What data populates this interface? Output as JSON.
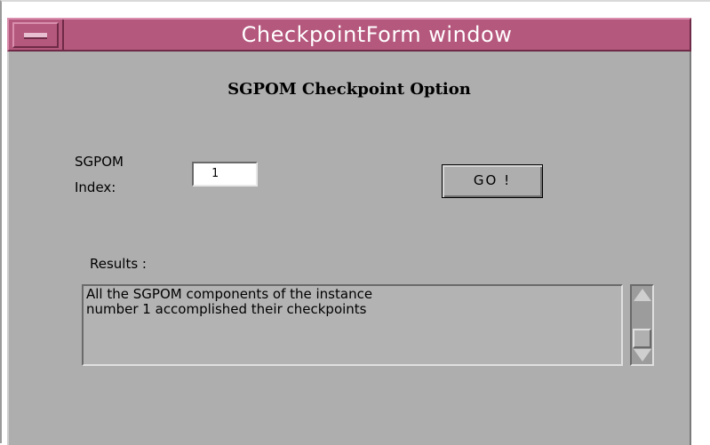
{
  "window": {
    "title": "CheckpointForm window"
  },
  "form": {
    "heading": "SGPOM Checkpoint Option",
    "index_label": "SGPOM\nIndex:",
    "index_value": "1",
    "go_label": "GO !",
    "results_label": "Results :",
    "results_lines": [
      "All the SGPOM components of the instance",
      "number 1 accomplished their checkpoints"
    ]
  },
  "icons": {
    "window_menu": "window-menu-icon",
    "scroll_up": "arrow-up-icon",
    "scroll_down": "arrow-down-icon"
  },
  "colors": {
    "titlebar": "#b5587d",
    "panel": "#aeaeae",
    "title_text": "#ffffff"
  }
}
